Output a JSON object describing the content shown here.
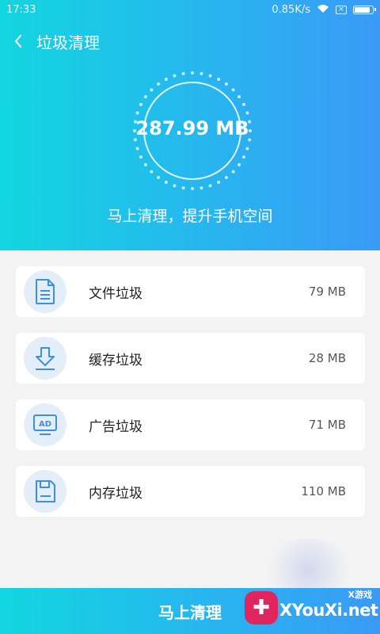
{
  "status_bar": {
    "time": "17:33",
    "speed": "0.85K/s"
  },
  "header": {
    "title": "垃圾清理"
  },
  "gauge": {
    "value": "287.99 MB"
  },
  "slogan": "马上清理，提升手机空间",
  "items": [
    {
      "label": "文件垃圾",
      "size": "79 MB",
      "icon": "file-icon"
    },
    {
      "label": "缓存垃圾",
      "size": "28 MB",
      "icon": "download-icon"
    },
    {
      "label": "广告垃圾",
      "size": "71 MB",
      "icon": "ad-monitor-icon"
    },
    {
      "label": "内存垃圾",
      "size": "110 MB",
      "icon": "memory-card-icon"
    }
  ],
  "bottom_button": {
    "label": "马上清理"
  },
  "watermark": {
    "top": "X游戏",
    "text": "XYouXi.net"
  },
  "colors": {
    "gradient_start": "#12d6e0",
    "gradient_end": "#3a9af6",
    "icon_blue": "#3d8fe0",
    "icon_bg": "#e3eef9",
    "page_bg": "#f3f3f3"
  }
}
